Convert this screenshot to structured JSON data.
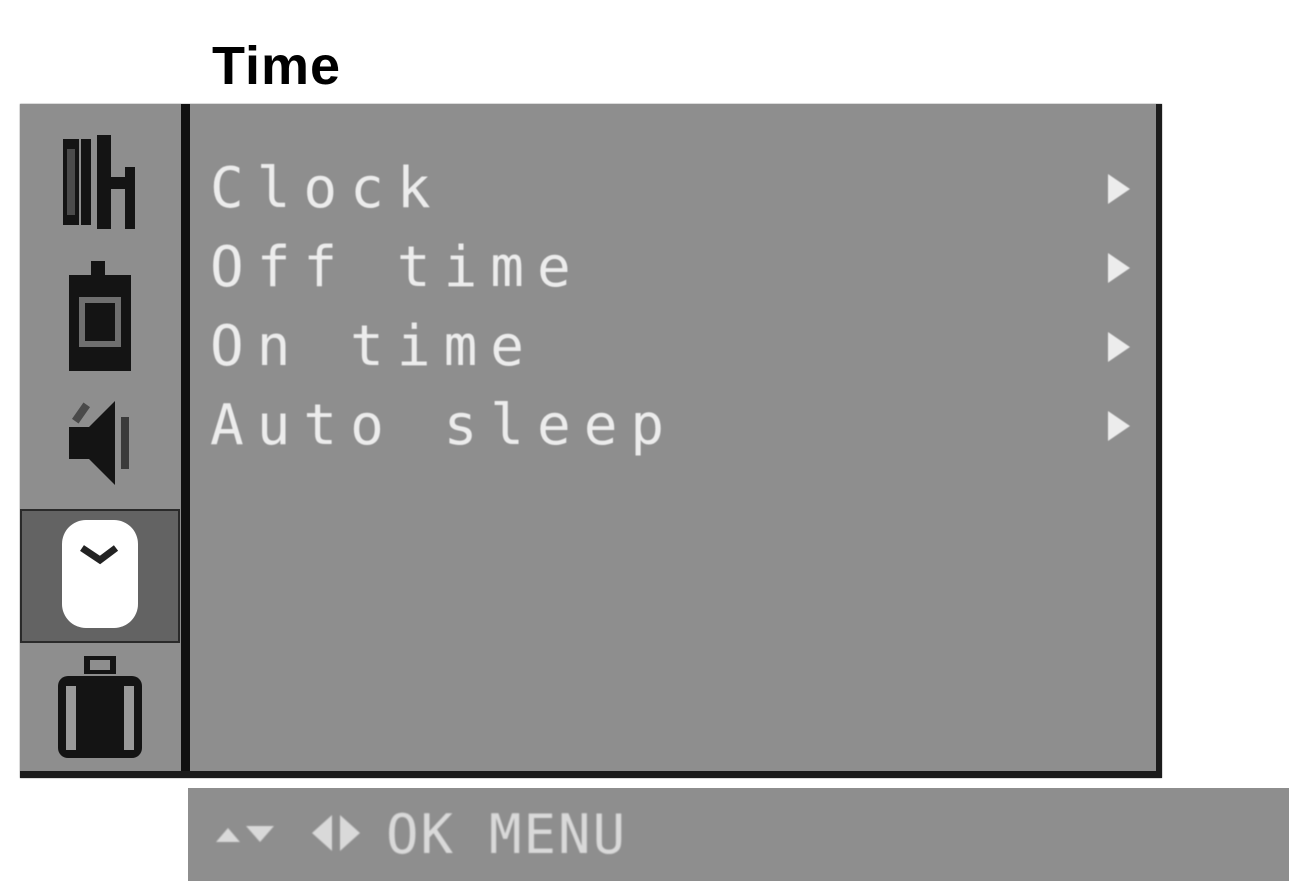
{
  "page": {
    "title": "Time"
  },
  "sidebar": {
    "items": [
      {
        "icon": "channel-icon",
        "selected": false
      },
      {
        "icon": "picture-icon",
        "selected": false
      },
      {
        "icon": "speaker-icon",
        "selected": false
      },
      {
        "icon": "clock-icon",
        "selected": true
      },
      {
        "icon": "lock-icon",
        "selected": false
      }
    ]
  },
  "menu": {
    "items": [
      {
        "label": "Clock",
        "arrow": "submenu-arrow-icon"
      },
      {
        "label": "Off time",
        "arrow": "submenu-arrow-icon"
      },
      {
        "label": "On time",
        "arrow": "submenu-arrow-icon"
      },
      {
        "label": "Auto sleep",
        "arrow": "submenu-arrow-icon"
      }
    ]
  },
  "hint_bar": {
    "ok_label": "OK",
    "menu_label": "MENU",
    "icons": [
      "up-down-arrows-icon",
      "left-right-arrows-icon"
    ]
  },
  "colors": {
    "panel": "#8e8e8e",
    "text": "#ececec",
    "frame": "#1c1c1c",
    "selected_item": "#636363"
  }
}
